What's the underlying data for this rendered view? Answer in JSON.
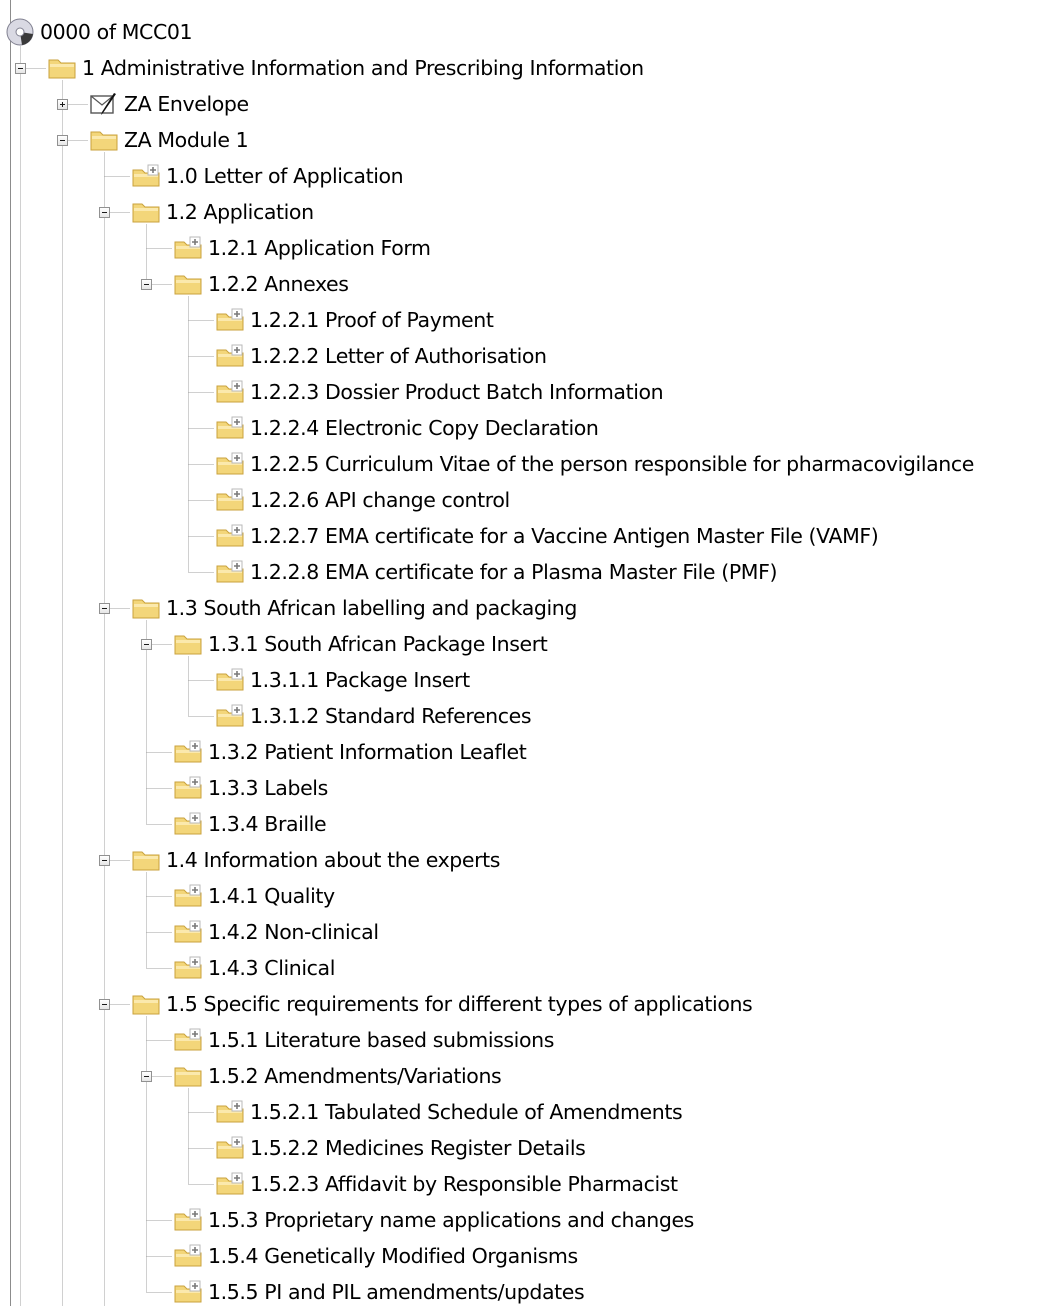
{
  "tree": {
    "nodes": [
      {
        "id": "root",
        "label": "0000 of MCC01",
        "level": 0,
        "icon": "cd-disc-icon",
        "expander": "none",
        "last": true
      },
      {
        "id": "m1",
        "label": "1 Administrative Information and Prescribing Information",
        "level": 1,
        "icon": "folder-icon",
        "expander": "expanded",
        "last": true
      },
      {
        "id": "env",
        "label": "ZA Envelope",
        "level": 2,
        "icon": "envelope-edit-icon",
        "expander": "collapsed",
        "last": false
      },
      {
        "id": "zam1",
        "label": "ZA Module 1",
        "level": 2,
        "icon": "folder-icon",
        "expander": "expanded",
        "last": true
      },
      {
        "id": "1.0",
        "label": "1.0 Letter of Application",
        "level": 3,
        "icon": "folder-add-icon",
        "expander": "none",
        "last": false
      },
      {
        "id": "1.2",
        "label": "1.2 Application",
        "level": 3,
        "icon": "folder-icon",
        "expander": "expanded",
        "last": false
      },
      {
        "id": "1.2.1",
        "label": "1.2.1 Application Form",
        "level": 4,
        "icon": "folder-add-icon",
        "expander": "none",
        "last": false
      },
      {
        "id": "1.2.2",
        "label": "1.2.2 Annexes",
        "level": 4,
        "icon": "folder-icon",
        "expander": "expanded",
        "last": true
      },
      {
        "id": "1.2.2.1",
        "label": "1.2.2.1 Proof of Payment",
        "level": 5,
        "icon": "folder-add-icon",
        "expander": "none",
        "last": false
      },
      {
        "id": "1.2.2.2",
        "label": "1.2.2.2 Letter of Authorisation",
        "level": 5,
        "icon": "folder-add-icon",
        "expander": "none",
        "last": false
      },
      {
        "id": "1.2.2.3",
        "label": "1.2.2.3 Dossier Product Batch Information",
        "level": 5,
        "icon": "folder-add-icon",
        "expander": "none",
        "last": false
      },
      {
        "id": "1.2.2.4",
        "label": "1.2.2.4 Electronic Copy Declaration",
        "level": 5,
        "icon": "folder-add-icon",
        "expander": "none",
        "last": false
      },
      {
        "id": "1.2.2.5",
        "label": "1.2.2.5 Curriculum Vitae of the person responsible for pharmacovigilance",
        "level": 5,
        "icon": "folder-add-icon",
        "expander": "none",
        "last": false
      },
      {
        "id": "1.2.2.6",
        "label": "1.2.2.6 API change control",
        "level": 5,
        "icon": "folder-add-icon",
        "expander": "none",
        "last": false
      },
      {
        "id": "1.2.2.7",
        "label": "1.2.2.7 EMA certificate for a Vaccine Antigen Master File (VAMF)",
        "level": 5,
        "icon": "folder-add-icon",
        "expander": "none",
        "last": false
      },
      {
        "id": "1.2.2.8",
        "label": "1.2.2.8 EMA certificate for a Plasma Master File (PMF)",
        "level": 5,
        "icon": "folder-add-icon",
        "expander": "none",
        "last": true
      },
      {
        "id": "1.3",
        "label": "1.3 South African labelling and packaging",
        "level": 3,
        "icon": "folder-icon",
        "expander": "expanded",
        "last": false
      },
      {
        "id": "1.3.1",
        "label": "1.3.1 South African Package Insert",
        "level": 4,
        "icon": "folder-icon",
        "expander": "expanded",
        "last": false
      },
      {
        "id": "1.3.1.1",
        "label": "1.3.1.1 Package Insert",
        "level": 5,
        "icon": "folder-add-icon",
        "expander": "none",
        "last": false
      },
      {
        "id": "1.3.1.2",
        "label": "1.3.1.2 Standard References",
        "level": 5,
        "icon": "folder-add-icon",
        "expander": "none",
        "last": true
      },
      {
        "id": "1.3.2",
        "label": "1.3.2 Patient Information Leaflet",
        "level": 4,
        "icon": "folder-add-icon",
        "expander": "none",
        "last": false
      },
      {
        "id": "1.3.3",
        "label": "1.3.3 Labels",
        "level": 4,
        "icon": "folder-add-icon",
        "expander": "none",
        "last": false
      },
      {
        "id": "1.3.4",
        "label": "1.3.4 Braille",
        "level": 4,
        "icon": "folder-add-icon",
        "expander": "none",
        "last": true
      },
      {
        "id": "1.4",
        "label": "1.4 Information about the experts",
        "level": 3,
        "icon": "folder-icon",
        "expander": "expanded",
        "last": false
      },
      {
        "id": "1.4.1",
        "label": "1.4.1 Quality",
        "level": 4,
        "icon": "folder-add-icon",
        "expander": "none",
        "last": false
      },
      {
        "id": "1.4.2",
        "label": "1.4.2 Non-clinical",
        "level": 4,
        "icon": "folder-add-icon",
        "expander": "none",
        "last": false
      },
      {
        "id": "1.4.3",
        "label": "1.4.3 Clinical",
        "level": 4,
        "icon": "folder-add-icon",
        "expander": "none",
        "last": true
      },
      {
        "id": "1.5",
        "label": "1.5 Specific requirements for different types of applications",
        "level": 3,
        "icon": "folder-icon",
        "expander": "expanded",
        "last": false
      },
      {
        "id": "1.5.1",
        "label": "1.5.1 Literature based submissions",
        "level": 4,
        "icon": "folder-add-icon",
        "expander": "none",
        "last": false
      },
      {
        "id": "1.5.2",
        "label": "1.5.2 Amendments/Variations",
        "level": 4,
        "icon": "folder-icon",
        "expander": "expanded",
        "last": false
      },
      {
        "id": "1.5.2.1",
        "label": "1.5.2.1 Tabulated Schedule of Amendments",
        "level": 5,
        "icon": "folder-add-icon",
        "expander": "none",
        "last": false
      },
      {
        "id": "1.5.2.2",
        "label": "1.5.2.2 Medicines Register Details",
        "level": 5,
        "icon": "folder-add-icon",
        "expander": "none",
        "last": false
      },
      {
        "id": "1.5.2.3",
        "label": "1.5.2.3 Affidavit by Responsible Pharmacist",
        "level": 5,
        "icon": "folder-add-icon",
        "expander": "none",
        "last": true
      },
      {
        "id": "1.5.3",
        "label": "1.5.3 Proprietary name applications and changes",
        "level": 4,
        "icon": "folder-add-icon",
        "expander": "none",
        "last": false
      },
      {
        "id": "1.5.4",
        "label": "1.5.4 Genetically Modified Organisms",
        "level": 4,
        "icon": "folder-add-icon",
        "expander": "none",
        "last": false
      },
      {
        "id": "1.5.5",
        "label": "1.5.5 PI and PIL amendments/updates",
        "level": 4,
        "icon": "folder-add-icon",
        "expander": "none",
        "last": true
      }
    ]
  },
  "colors": {
    "folder_fill": "#f3d67a",
    "folder_edge": "#c9a23c",
    "folder_light": "#fbe9ad",
    "tree_lines": "#a0a0a0",
    "text": "#000000"
  }
}
